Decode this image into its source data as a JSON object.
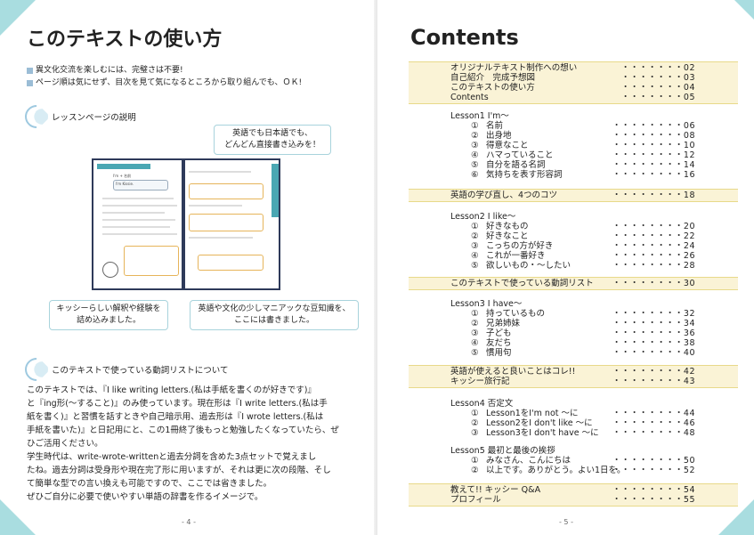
{
  "left": {
    "title": "このテキストの使い方",
    "bullets": [
      "異文化交流を楽しむには、完璧さは不要!",
      "ページ順は気にせず、目次を見て気になるところから取り組んでも、ＯＫ!"
    ],
    "section1": "レッスンページの説明",
    "callout_top": [
      "英語でも日本語でも、",
      "どんどん直接書き込みを！"
    ],
    "callout_left": [
      "キッシーらしい解釈や経験を",
      "詰め込みました。"
    ],
    "callout_right": [
      "英語や文化の少しマニアックな豆知識を、",
      "ここには書きました。"
    ],
    "mock": {
      "heading": "I'm + 名前",
      "sub": "名前は？",
      "name": "I'm Kissie."
    },
    "section2": "このテキストで使っている動詞リストについて",
    "body": [
      "このテキストでは、『I like writing letters.(私は手紙を書くのが好きです)』",
      "と『ing形(～すること)』のみ使っています。現在形は『I write letters.(私は手",
      "紙を書く)』と習慣を話すときや自己暗示用、過去形は『I wrote letters.(私は",
      "手紙を書いた)』と日記用にと、この1冊終了後もっと勉強したくなっていたら、ぜ",
      "ひご活用ください。",
      "学生時代は、write-wrote-writtenと過去分詞を含めた3点セットで覚えまし",
      "たね。過去分詞は受身形や現在完了形に用いますが、それは更に次の段階、そし",
      "て簡単な型での言い換えも可能ですので、ここでは省きました。",
      "ぜひご自分に必要で使いやすい単語の辞書を作るイメージで。"
    ],
    "page_number": "- 4 -"
  },
  "right": {
    "title": "Contents",
    "blocks": [
      {
        "tint": true,
        "rows": [
          {
            "t": "オリジナルテキスト制作への想い",
            "p": "・・・・・・・02"
          },
          {
            "t": "自己紹介　完成予想図",
            "p": "・・・・・・・03"
          },
          {
            "t": "このテキストの使い方",
            "p": "・・・・・・・04"
          },
          {
            "t": "Contents",
            "p": "・・・・・・・05"
          }
        ]
      },
      {
        "tint": false,
        "rows": [
          {
            "t": "Lesson1  I'm～",
            "p": ""
          },
          {
            "n": "①",
            "t": "名前",
            "p": "・・・・・・・・06"
          },
          {
            "n": "②",
            "t": "出身地",
            "p": "・・・・・・・・08"
          },
          {
            "n": "③",
            "t": "得意なこと",
            "p": "・・・・・・・・10"
          },
          {
            "n": "④",
            "t": "ハマっていること",
            "p": "・・・・・・・・12"
          },
          {
            "n": "⑤",
            "t": "自分を語る名詞",
            "p": "・・・・・・・・14"
          },
          {
            "n": "⑥",
            "t": "気持ちを表す形容詞",
            "p": "・・・・・・・・16"
          }
        ]
      },
      {
        "tint": true,
        "rows": [
          {
            "t": "英語の学び直し、4つのコツ",
            "p": "・・・・・・・・18"
          }
        ]
      },
      {
        "tint": false,
        "rows": [
          {
            "t": "Lesson2  I like～",
            "p": ""
          },
          {
            "n": "①",
            "t": "好きなもの",
            "p": "・・・・・・・・20"
          },
          {
            "n": "②",
            "t": "好きなこと",
            "p": "・・・・・・・・22"
          },
          {
            "n": "③",
            "t": "こっちの方が好き",
            "p": "・・・・・・・・24"
          },
          {
            "n": "④",
            "t": "これが一番好き",
            "p": "・・・・・・・・26"
          },
          {
            "n": "⑤",
            "t": "欲しいもの・～したい",
            "p": "・・・・・・・・28"
          }
        ]
      },
      {
        "tint": true,
        "rows": [
          {
            "t": "このテキストで使っている動詞リスト",
            "p": "・・・・・・・・30"
          }
        ]
      },
      {
        "tint": false,
        "rows": [
          {
            "t": "Lesson3  I have～",
            "p": ""
          },
          {
            "n": "①",
            "t": "持っているもの",
            "p": "・・・・・・・・32"
          },
          {
            "n": "②",
            "t": "兄弟姉妹",
            "p": "・・・・・・・・34"
          },
          {
            "n": "③",
            "t": "子ども",
            "p": "・・・・・・・・36"
          },
          {
            "n": "④",
            "t": "友だち",
            "p": "・・・・・・・・38"
          },
          {
            "n": "⑤",
            "t": "慣用句",
            "p": "・・・・・・・・40"
          }
        ]
      },
      {
        "tint": true,
        "rows": [
          {
            "t": "英語が使えると良いことはコレ!!",
            "p": "・・・・・・・・42"
          },
          {
            "t": "キッシー旅行記",
            "p": "・・・・・・・・43"
          }
        ]
      },
      {
        "tint": false,
        "rows": [
          {
            "t": "Lesson4  否定文",
            "p": ""
          },
          {
            "n": "①",
            "t": "Lesson1をI'm not ～に",
            "p": "・・・・・・・・44"
          },
          {
            "n": "②",
            "t": "Lesson2をI don't like ～に",
            "p": "・・・・・・・・46"
          },
          {
            "n": "③",
            "t": "Lesson3をI don't have ～に",
            "p": "・・・・・・・・48"
          }
        ]
      },
      {
        "tint": false,
        "rows": [
          {
            "t": "Lesson5  最初と最後の挨拶",
            "p": ""
          },
          {
            "n": "①",
            "t": "みなさん、こんにちは",
            "p": "・・・・・・・・50"
          },
          {
            "n": "②",
            "t": "以上です。ありがとう。よい1日を。",
            "p": "・・・・・・・・52"
          }
        ]
      },
      {
        "tint": true,
        "rows": [
          {
            "t": "教えて!! キッシー  Q&A",
            "p": "・・・・・・・・54"
          },
          {
            "t": "プロフィール",
            "p": "・・・・・・・・55"
          }
        ]
      }
    ],
    "page_number": "- 5 -"
  },
  "colors": {
    "accent": "#a9dde0",
    "tint": "#faf3d6",
    "callout_border": "#a8d3dc"
  }
}
